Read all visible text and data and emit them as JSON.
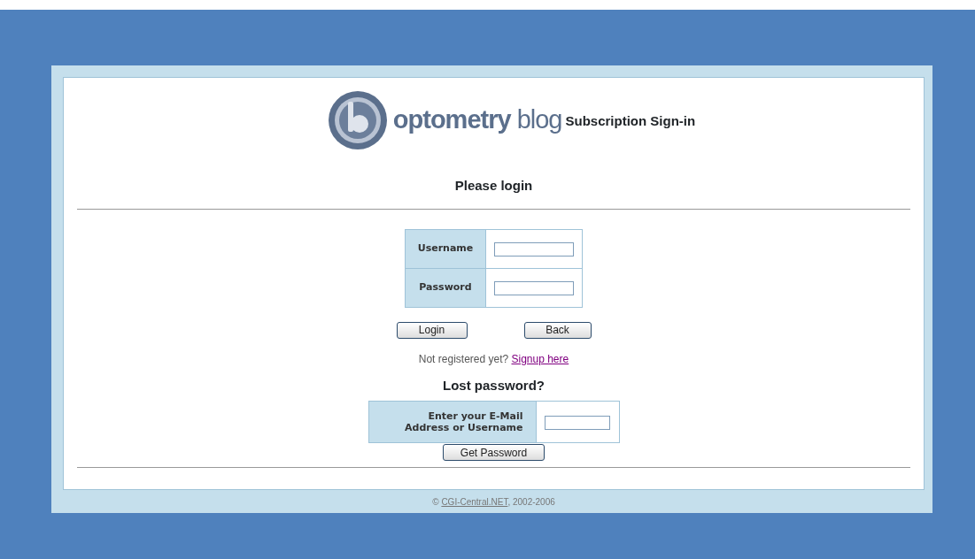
{
  "header": {
    "logo_text": "**optometry** blog",
    "title": "Subscription Sign-in"
  },
  "login": {
    "heading": "Please login",
    "fields": [
      {
        "label": "Username"
      },
      {
        "label": "Password"
      }
    ],
    "buttons": [
      "Login",
      "Back"
    ],
    "signup": {
      "text": "Not registered yet?",
      "link": "Signup here"
    }
  },
  "lost_password": {
    "heading": "Lost password?",
    "label": "Enter your E-Mail Address or Username",
    "button": "Get Password"
  },
  "footer": {
    "prefix": "©",
    "link": "CGI-Central.NET",
    "suffix": ", 2002-2006"
  }
}
